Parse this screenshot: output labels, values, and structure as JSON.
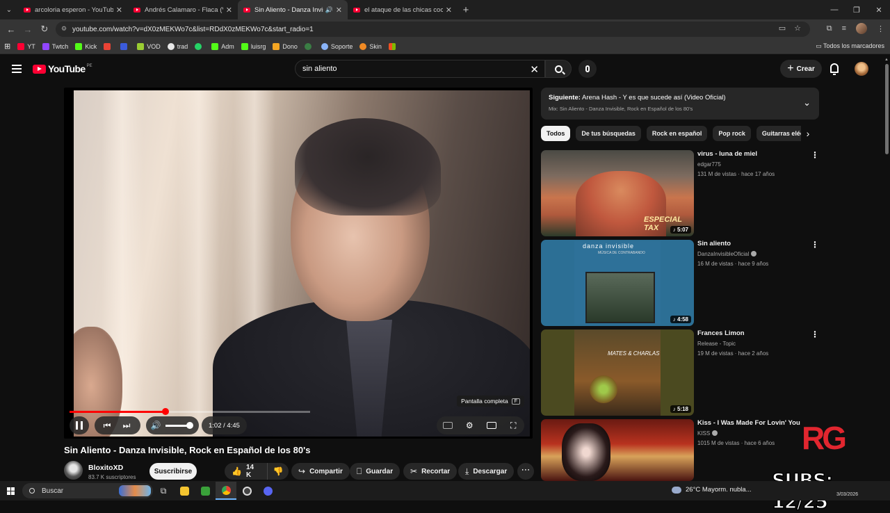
{
  "browser": {
    "tabs": [
      {
        "title": "arcoloria esperon - YouTube",
        "active": false,
        "audio": false
      },
      {
        "title": "Andrés Calamaro - Flaca (Video",
        "active": false,
        "audio": false
      },
      {
        "title": "Sin Aliento - Danza Invisible",
        "active": true,
        "audio": true
      },
      {
        "title": "el ataque de las chicas cocodril",
        "active": false,
        "audio": false
      }
    ],
    "url": "youtube.com/watch?v=dX0zMEKWo7c&list=RDdX0zMEKWo7c&start_radio=1",
    "bookmarks": [
      {
        "label": "YT",
        "color": "#ff0033"
      },
      {
        "label": "Twtch",
        "color": "#9146ff"
      },
      {
        "label": "Kick",
        "color": "#53fc18"
      },
      {
        "label": "",
        "color": "#ea4335"
      },
      {
        "label": "",
        "color": "#3b5bdb"
      },
      {
        "label": "VOD",
        "color": "#9acd32"
      },
      {
        "label": "trad",
        "color": "#e8e8e8"
      },
      {
        "label": "",
        "color": "#25d366"
      },
      {
        "label": "Adm",
        "color": "#53fc18"
      },
      {
        "label": "luisrg",
        "color": "#53fc18"
      },
      {
        "label": "Dono",
        "color": "#f5a623"
      },
      {
        "label": "",
        "color": "#3a7d44"
      },
      {
        "label": "Soporte",
        "color": "#8ab4f8"
      },
      {
        "label": "Skin",
        "color": "#f08a24"
      },
      {
        "label": "",
        "color": "#f25022"
      }
    ],
    "all_bookmarks": "Todos los marcadores"
  },
  "header": {
    "logo_text": "YouTube",
    "region": "PE",
    "search_value": "sin aliento",
    "create_label": "Crear"
  },
  "player": {
    "fullscreen_tooltip": "Pantalla completa",
    "fullscreen_key": "F",
    "time_display": "1:02 / 4:45",
    "progress": 0.4
  },
  "video": {
    "title": "Sin Aliento - Danza Invisible, Rock en Español de los 80's",
    "channel": "BloxitoXD",
    "subscribers": "83.7 K suscriptores",
    "subscribe_label": "Suscribirse",
    "likes": "14 K",
    "share_label": "Compartir",
    "save_label": "Guardar",
    "clip_label": "Recortar",
    "download_label": "Descargar"
  },
  "up_next": {
    "label": "Siguiente:",
    "title": "Arena Hash - Y es que sucede así (Video Oficial)",
    "mix": "Mix: Sin Aliento - Danza Invisible, Rock en Español de los 80's"
  },
  "chips": [
    "Todos",
    "De tus búsquedas",
    "Rock en español",
    "Pop rock",
    "Guitarras eléctr"
  ],
  "recommendations": [
    {
      "title": "virus - luna de miel",
      "channel": "edgar775",
      "verified": false,
      "meta": "131 M de vistas · hace 17 años",
      "duration": "5:07"
    },
    {
      "title": "Sin aliento",
      "channel": "DanzaInvisibleOficial",
      "verified": true,
      "meta": "16 M de vistas · hace 9 años",
      "duration": "4:58"
    },
    {
      "title": "Frances Limon",
      "channel": "Release - Topic",
      "verified": false,
      "meta": "19 M de vistas · hace 2 años",
      "duration": "5:18"
    },
    {
      "title": "Kiss - I Was Made For Lovin' You",
      "channel": "KISS",
      "verified": true,
      "meta": "1015 M de vistas · hace 6 años",
      "duration": ""
    }
  ],
  "thumbnail_text": {
    "t1": "ESPECIAL TAX",
    "t2_top": "danza invisible",
    "t2_sub": "MÚSICA DE CONTRABANDO",
    "t3": "MATES & CHARLAS"
  },
  "overlay": {
    "logo": "RG",
    "subs": "SUBS: 12/25"
  },
  "taskbar": {
    "search": "Buscar",
    "weather": "26°C  Mayorm. nubla...",
    "date": "3/03/2026"
  }
}
